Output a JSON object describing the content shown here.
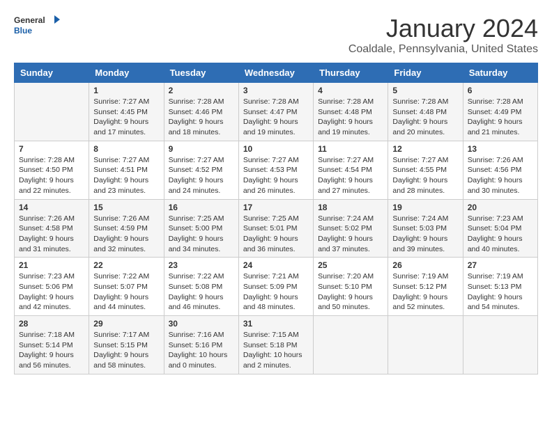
{
  "logo": {
    "general": "General",
    "blue": "Blue"
  },
  "header": {
    "month": "January 2024",
    "location": "Coaldale, Pennsylvania, United States"
  },
  "days_of_week": [
    "Sunday",
    "Monday",
    "Tuesday",
    "Wednesday",
    "Thursday",
    "Friday",
    "Saturday"
  ],
  "weeks": [
    [
      {
        "day": "",
        "content": ""
      },
      {
        "day": "1",
        "content": "Sunrise: 7:27 AM\nSunset: 4:45 PM\nDaylight: 9 hours\nand 17 minutes."
      },
      {
        "day": "2",
        "content": "Sunrise: 7:28 AM\nSunset: 4:46 PM\nDaylight: 9 hours\nand 18 minutes."
      },
      {
        "day": "3",
        "content": "Sunrise: 7:28 AM\nSunset: 4:47 PM\nDaylight: 9 hours\nand 19 minutes."
      },
      {
        "day": "4",
        "content": "Sunrise: 7:28 AM\nSunset: 4:48 PM\nDaylight: 9 hours\nand 19 minutes."
      },
      {
        "day": "5",
        "content": "Sunrise: 7:28 AM\nSunset: 4:48 PM\nDaylight: 9 hours\nand 20 minutes."
      },
      {
        "day": "6",
        "content": "Sunrise: 7:28 AM\nSunset: 4:49 PM\nDaylight: 9 hours\nand 21 minutes."
      }
    ],
    [
      {
        "day": "7",
        "content": "Sunrise: 7:28 AM\nSunset: 4:50 PM\nDaylight: 9 hours\nand 22 minutes."
      },
      {
        "day": "8",
        "content": "Sunrise: 7:27 AM\nSunset: 4:51 PM\nDaylight: 9 hours\nand 23 minutes."
      },
      {
        "day": "9",
        "content": "Sunrise: 7:27 AM\nSunset: 4:52 PM\nDaylight: 9 hours\nand 24 minutes."
      },
      {
        "day": "10",
        "content": "Sunrise: 7:27 AM\nSunset: 4:53 PM\nDaylight: 9 hours\nand 26 minutes."
      },
      {
        "day": "11",
        "content": "Sunrise: 7:27 AM\nSunset: 4:54 PM\nDaylight: 9 hours\nand 27 minutes."
      },
      {
        "day": "12",
        "content": "Sunrise: 7:27 AM\nSunset: 4:55 PM\nDaylight: 9 hours\nand 28 minutes."
      },
      {
        "day": "13",
        "content": "Sunrise: 7:26 AM\nSunset: 4:56 PM\nDaylight: 9 hours\nand 30 minutes."
      }
    ],
    [
      {
        "day": "14",
        "content": "Sunrise: 7:26 AM\nSunset: 4:58 PM\nDaylight: 9 hours\nand 31 minutes."
      },
      {
        "day": "15",
        "content": "Sunrise: 7:26 AM\nSunset: 4:59 PM\nDaylight: 9 hours\nand 32 minutes."
      },
      {
        "day": "16",
        "content": "Sunrise: 7:25 AM\nSunset: 5:00 PM\nDaylight: 9 hours\nand 34 minutes."
      },
      {
        "day": "17",
        "content": "Sunrise: 7:25 AM\nSunset: 5:01 PM\nDaylight: 9 hours\nand 36 minutes."
      },
      {
        "day": "18",
        "content": "Sunrise: 7:24 AM\nSunset: 5:02 PM\nDaylight: 9 hours\nand 37 minutes."
      },
      {
        "day": "19",
        "content": "Sunrise: 7:24 AM\nSunset: 5:03 PM\nDaylight: 9 hours\nand 39 minutes."
      },
      {
        "day": "20",
        "content": "Sunrise: 7:23 AM\nSunset: 5:04 PM\nDaylight: 9 hours\nand 40 minutes."
      }
    ],
    [
      {
        "day": "21",
        "content": "Sunrise: 7:23 AM\nSunset: 5:06 PM\nDaylight: 9 hours\nand 42 minutes."
      },
      {
        "day": "22",
        "content": "Sunrise: 7:22 AM\nSunset: 5:07 PM\nDaylight: 9 hours\nand 44 minutes."
      },
      {
        "day": "23",
        "content": "Sunrise: 7:22 AM\nSunset: 5:08 PM\nDaylight: 9 hours\nand 46 minutes."
      },
      {
        "day": "24",
        "content": "Sunrise: 7:21 AM\nSunset: 5:09 PM\nDaylight: 9 hours\nand 48 minutes."
      },
      {
        "day": "25",
        "content": "Sunrise: 7:20 AM\nSunset: 5:10 PM\nDaylight: 9 hours\nand 50 minutes."
      },
      {
        "day": "26",
        "content": "Sunrise: 7:19 AM\nSunset: 5:12 PM\nDaylight: 9 hours\nand 52 minutes."
      },
      {
        "day": "27",
        "content": "Sunrise: 7:19 AM\nSunset: 5:13 PM\nDaylight: 9 hours\nand 54 minutes."
      }
    ],
    [
      {
        "day": "28",
        "content": "Sunrise: 7:18 AM\nSunset: 5:14 PM\nDaylight: 9 hours\nand 56 minutes."
      },
      {
        "day": "29",
        "content": "Sunrise: 7:17 AM\nSunset: 5:15 PM\nDaylight: 9 hours\nand 58 minutes."
      },
      {
        "day": "30",
        "content": "Sunrise: 7:16 AM\nSunset: 5:16 PM\nDaylight: 10 hours\nand 0 minutes."
      },
      {
        "day": "31",
        "content": "Sunrise: 7:15 AM\nSunset: 5:18 PM\nDaylight: 10 hours\nand 2 minutes."
      },
      {
        "day": "",
        "content": ""
      },
      {
        "day": "",
        "content": ""
      },
      {
        "day": "",
        "content": ""
      }
    ]
  ]
}
